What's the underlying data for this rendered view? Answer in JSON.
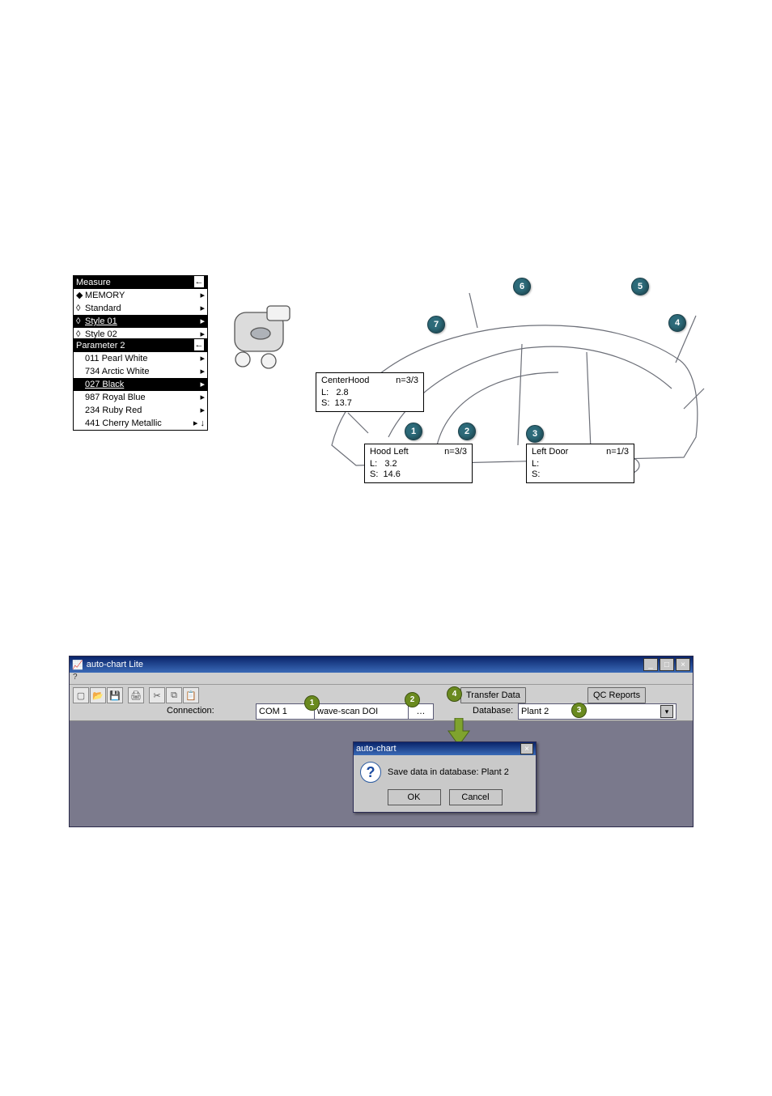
{
  "top": {
    "menu1": {
      "header": "Measure",
      "items": [
        {
          "marker": "◆",
          "label": "MEMORY",
          "sel": false
        },
        {
          "marker": "◊",
          "label": "Standard",
          "sel": false
        },
        {
          "marker": "◊",
          "label": "Style 01",
          "sel": true,
          "underline": true
        },
        {
          "marker": "◊",
          "label": "Style 02",
          "sel": false
        }
      ]
    },
    "menu2": {
      "header": "Parameter 2",
      "items": [
        {
          "label": "011 Pearl White",
          "sel": false
        },
        {
          "label": "734 Arctic White",
          "sel": false
        },
        {
          "label": "027 Black",
          "sel": true,
          "underline": true
        },
        {
          "label": "987 Royal Blue",
          "sel": false
        },
        {
          "label": "234 Ruby Red",
          "sel": false
        },
        {
          "label": "441 Cherry Metallic",
          "sel": false
        }
      ]
    },
    "callouts": {
      "center": {
        "title": "CenterHood",
        "n": "n=3/3",
        "L": "2.8",
        "S": "13.7"
      },
      "hoodleft": {
        "title": "Hood Left",
        "n": "n=3/3",
        "L": "3.2",
        "S": "14.6"
      },
      "leftdoor": {
        "title": "Left Door",
        "n": "n=1/3",
        "L": "",
        "S": ""
      }
    },
    "markers_top": [
      "1",
      "2",
      "3",
      "4",
      "5",
      "6",
      "7"
    ]
  },
  "win": {
    "title": "auto-chart Lite",
    "menubar": "?",
    "labels": {
      "connection": "Connection:",
      "database": "Database:",
      "transfer": "Transfer Data",
      "qc": "QC Reports"
    },
    "fields": {
      "com": "COM 1",
      "device": "wave-scan DOI",
      "database": "Plant 2"
    },
    "dialog": {
      "title": "auto-chart",
      "message": "Save data in database:   Plant 2",
      "ok": "OK",
      "cancel": "Cancel"
    },
    "step_markers": [
      "1",
      "2",
      "3",
      "4"
    ]
  }
}
